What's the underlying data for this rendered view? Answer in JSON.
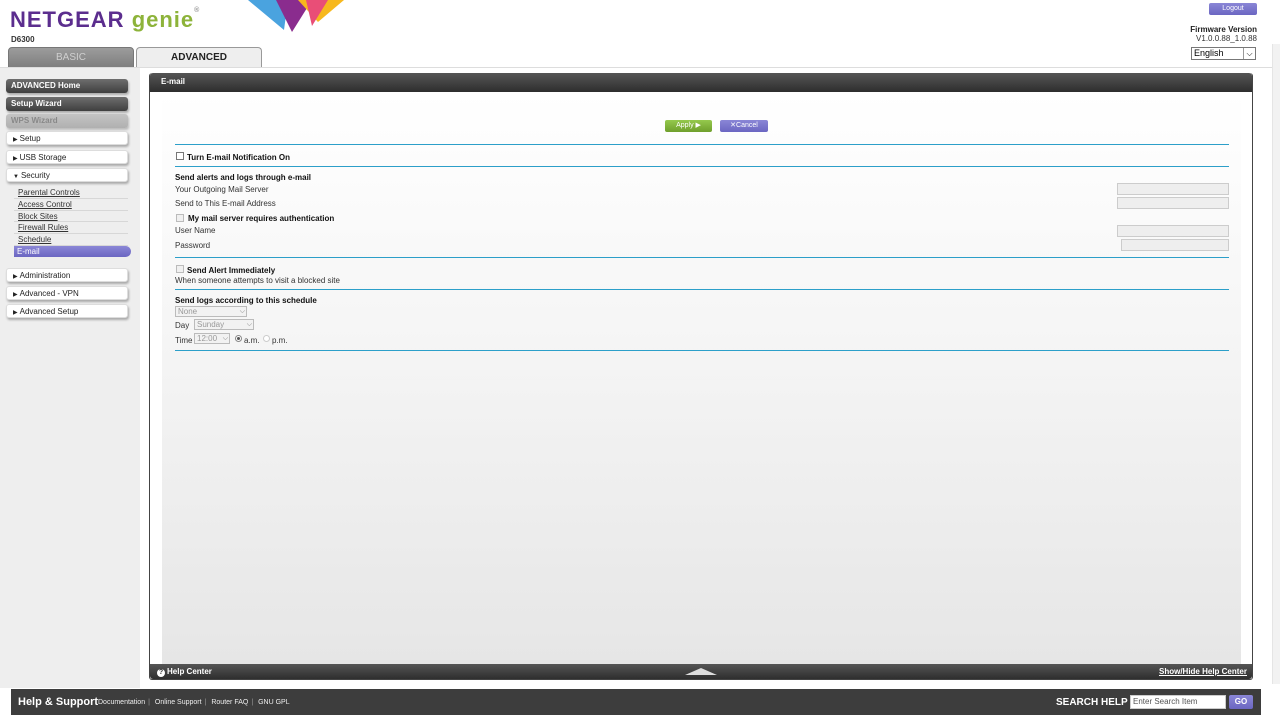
{
  "header": {
    "logo_netgear": "NETGEAR",
    "logo_genie": "genie",
    "logo_tm": "®",
    "model": "D6300",
    "logout_label": "Logout",
    "firmware_label": "Firmware Version",
    "firmware_value": "V1.0.0.88_1.0.88",
    "language_selected": "English",
    "tabs": [
      {
        "label": "BASIC",
        "active": false
      },
      {
        "label": "ADVANCED",
        "active": true
      }
    ]
  },
  "sidebar": {
    "advanced_home": "ADVANCED Home",
    "setup_wizard": "Setup Wizard",
    "wps_wizard": "WPS Wizard",
    "setup": "Setup",
    "usb_storage": "USB Storage",
    "security": "Security",
    "security_items": [
      "Parental Controls",
      "Access Control",
      "Block Sites",
      "Firewall Rules",
      "Schedule"
    ],
    "active_item": "E-mail",
    "administration": "Administration",
    "advanced_vpn": "Advanced - VPN",
    "advanced_setup": "Advanced Setup"
  },
  "panel": {
    "title": "E-mail",
    "apply_label": "Apply ▶",
    "cancel_label": "Cancel",
    "notify_label": "Turn E-mail Notification On",
    "send_alerts_heading": "Send alerts and logs through e-mail",
    "outgoing_server_label": "Your Outgoing Mail Server",
    "send_to_label": "Send to This E-mail Address",
    "auth_label": "My mail server requires authentication",
    "username_label": "User Name",
    "password_label": "Password",
    "alert_immediately_label": "Send Alert Immediately",
    "alert_desc": "When someone attempts to visit a blocked site",
    "schedule_heading": "Send logs according to this schedule",
    "schedule_selected": "None",
    "day_label": "Day",
    "day_selected": "Sunday",
    "time_label": "Time",
    "time_selected": "12:00",
    "am_label": "a.m.",
    "pm_label": "p.m.",
    "help_center": "Help Center",
    "show_hide": "Show/Hide Help Center"
  },
  "footer": {
    "help_support": "Help & Support",
    "links": [
      "Documentation",
      "Online Support",
      "Router FAQ",
      "GNU GPL"
    ],
    "search_help": "SEARCH HELP",
    "search_placeholder": "Enter Search Item",
    "go_label": "GO"
  },
  "colors": {
    "purple": "#6b66c2",
    "green": "#7fb13a",
    "rule_blue": "#2c9fc9",
    "dark_bar": "#3d3d3d"
  }
}
